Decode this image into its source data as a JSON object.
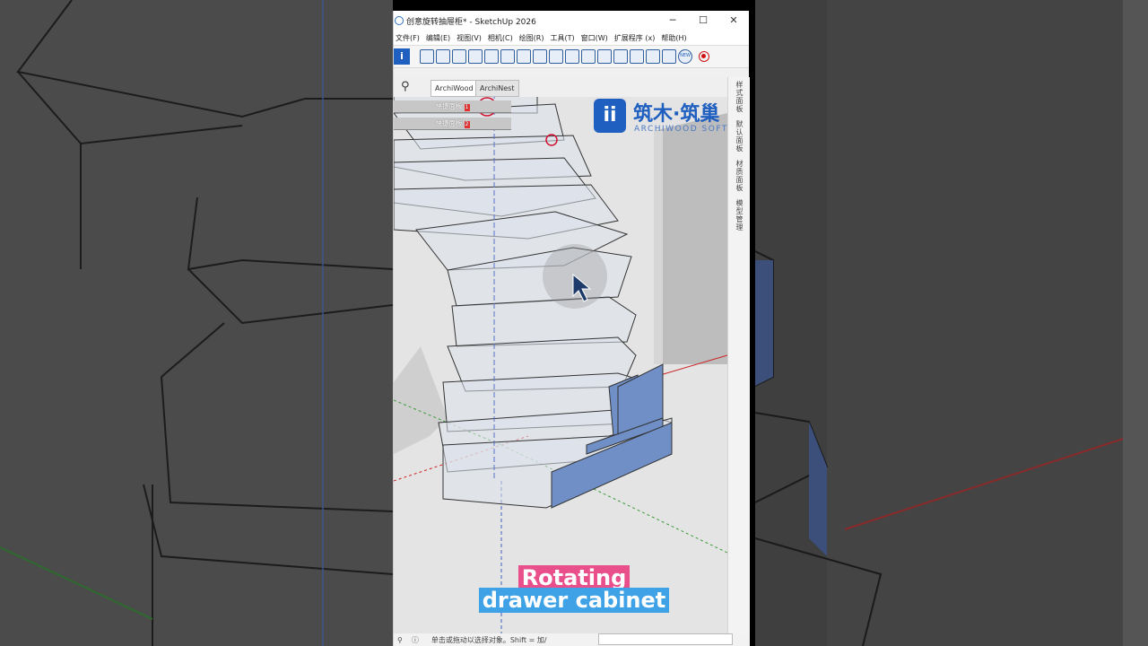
{
  "window": {
    "title": "创意旋转抽屉柜* - SketchUp 2026",
    "minimize_glyph": "─",
    "maximize_glyph": "☐",
    "close_glyph": "✕"
  },
  "menu": [
    "文件(F)",
    "编辑(E)",
    "视图(V)",
    "相机(C)",
    "绘图(R)",
    "工具(T)",
    "窗口(W)",
    "扩展程序 (x)",
    "帮助(H)"
  ],
  "toolbar": {
    "logo_glyph": "i",
    "new_badge": "NEW"
  },
  "panel": {
    "search_glyph": "⚲",
    "tabs": [
      "ArchiWood",
      "ArchiNest"
    ],
    "quick_panels": [
      {
        "label": "快捷面板",
        "num": "1"
      },
      {
        "label": "快捷面板",
        "num": "2"
      }
    ]
  },
  "right_tabs": [
    "样式面板",
    "默认面板",
    "材质面板",
    "模型管理"
  ],
  "brand": {
    "cn": "筑木·筑巢",
    "en": "ARCHIWOOD SOFT",
    "mark": "ii"
  },
  "status": {
    "text": "单击或拖动以选择对象。Shift = 加/"
  },
  "caption": {
    "line1": "Rotating",
    "line2": "drawer cabinet"
  },
  "colors": {
    "accent": "#1f5fbf",
    "caption_pink": "#e9508b",
    "caption_blue": "#3fa2e6",
    "drawer_blue": "#6f8fc6"
  }
}
